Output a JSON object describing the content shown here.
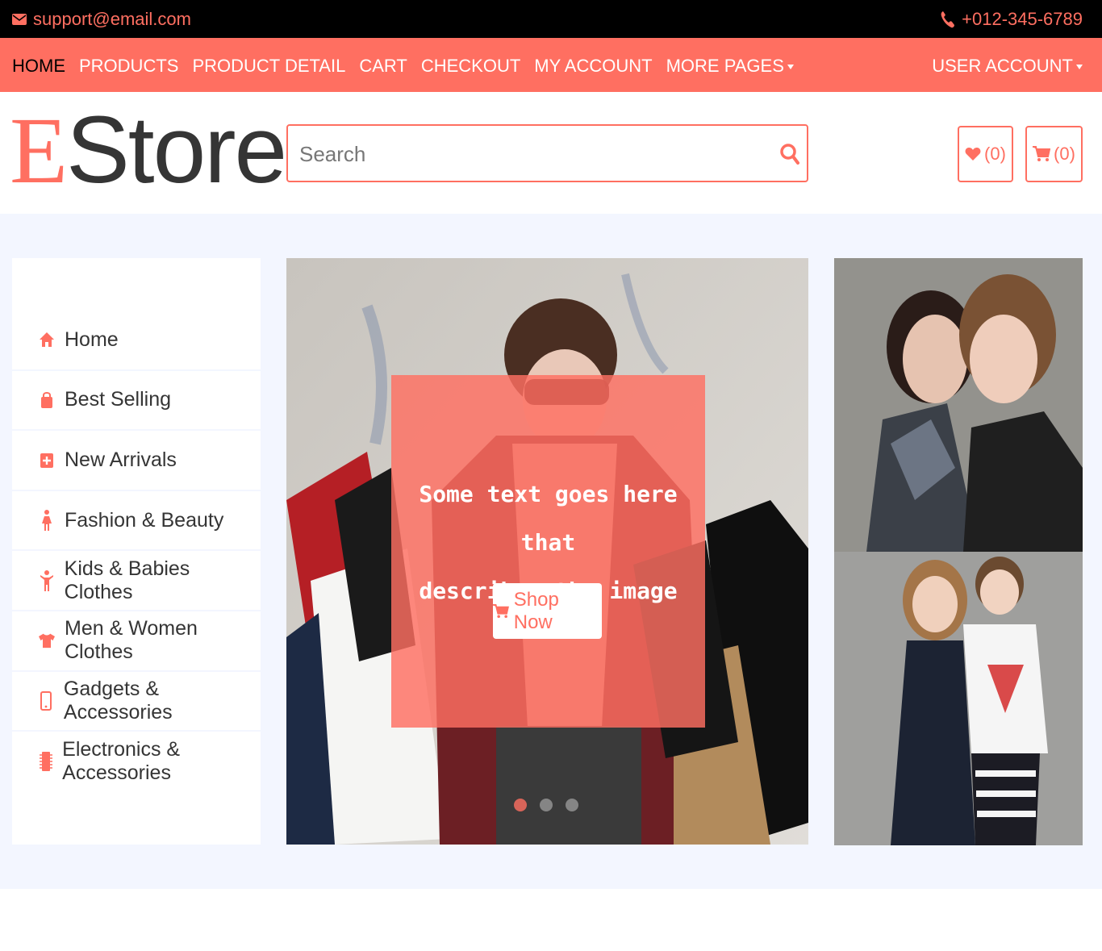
{
  "topbar": {
    "email": "support@email.com",
    "phone": "+012-345-6789"
  },
  "nav": {
    "items": [
      {
        "label": "HOME"
      },
      {
        "label": "PRODUCTS"
      },
      {
        "label": "PRODUCT DETAIL"
      },
      {
        "label": "CART"
      },
      {
        "label": "CHECKOUT"
      },
      {
        "label": "MY ACCOUNT"
      },
      {
        "label": "MORE PAGES"
      }
    ],
    "user_account": "USER ACCOUNT"
  },
  "header": {
    "logo_e": "E",
    "logo_rest": "Store",
    "search_placeholder": "Search",
    "wishlist_count": "(0)",
    "cart_count": "(0)"
  },
  "sidebar": {
    "items": [
      {
        "label": "Home",
        "icon": "home-icon"
      },
      {
        "label": "Best Selling",
        "icon": "shopping-bag-icon"
      },
      {
        "label": "New Arrivals",
        "icon": "plus-square-icon"
      },
      {
        "label": "Fashion & Beauty",
        "icon": "female-icon"
      },
      {
        "label": "Kids & Babies Clothes",
        "icon": "child-icon"
      },
      {
        "label": "Men & Women Clothes",
        "icon": "tshirt-icon"
      },
      {
        "label": "Gadgets & Accessories",
        "icon": "mobile-icon"
      },
      {
        "label": "Electronics & Accessories",
        "icon": "microchip-icon"
      }
    ]
  },
  "slider": {
    "caption_line1": "Some text goes here that",
    "caption_line2": "describes the image",
    "shop_label": "Shop Now",
    "slide_count": 3,
    "active_slide": 1
  },
  "colors": {
    "accent": "#ff6f61",
    "dark": "#000000",
    "background": "#f3f6ff",
    "text": "#353535"
  }
}
